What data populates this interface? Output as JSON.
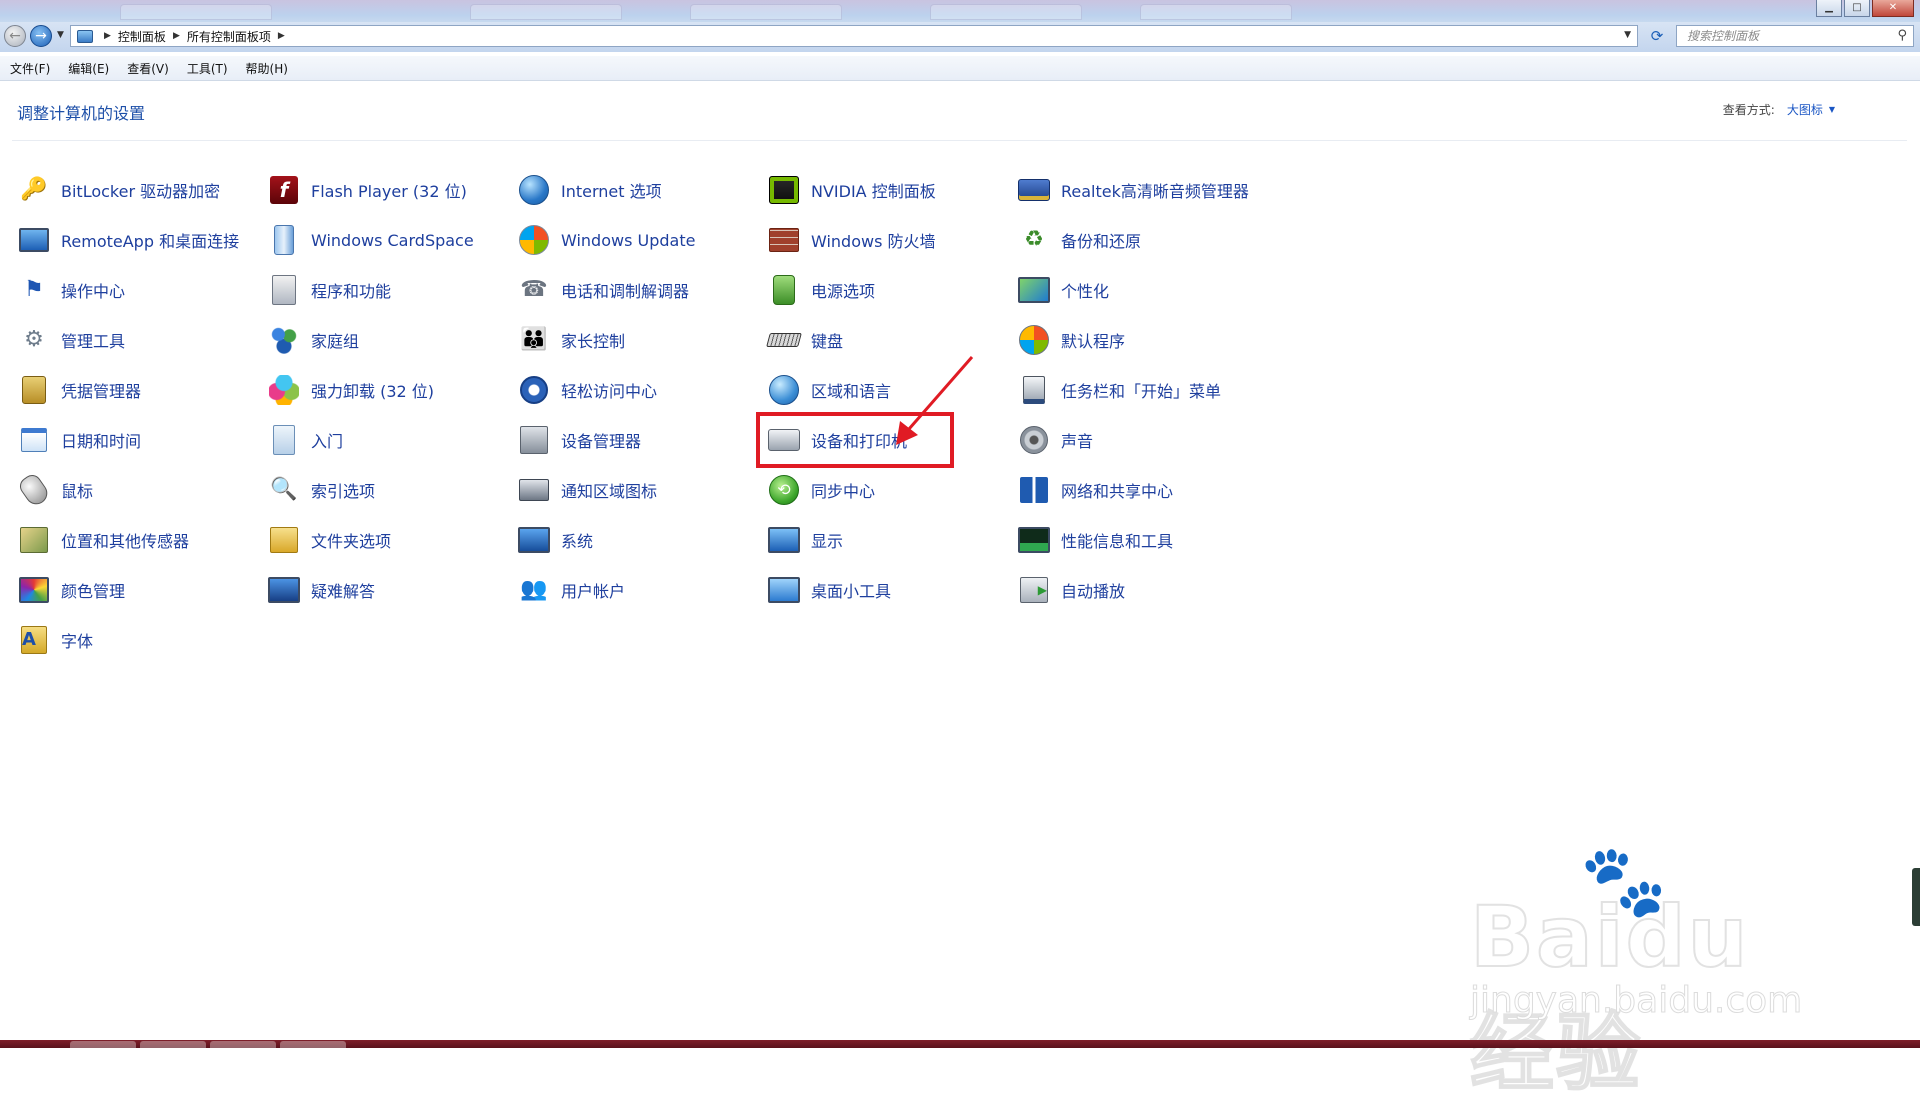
{
  "window": {
    "minimize_glyph": "▁",
    "maximize_glyph": "□",
    "close_glyph": "✕"
  },
  "address": {
    "crumbs": [
      "控制面板",
      "所有控制面板项"
    ],
    "search_placeholder": "搜索控制面板"
  },
  "menu": [
    "文件(F)",
    "编辑(E)",
    "查看(V)",
    "工具(T)",
    "帮助(H)"
  ],
  "content": {
    "heading": "调整计算机的设置",
    "view_by_label": "查看方式:",
    "view_by_value": "大图标"
  },
  "columns": [
    {
      "items": [
        {
          "label": "BitLocker 驱动器加密",
          "icon": "bitlocker-key-icon"
        },
        {
          "label": "RemoteApp 和桌面连接",
          "icon": "remoteapp-icon"
        },
        {
          "label": "操作中心",
          "icon": "action-center-flag-icon"
        },
        {
          "label": "管理工具",
          "icon": "admin-tools-icon"
        },
        {
          "label": "凭据管理器",
          "icon": "credential-manager-icon"
        },
        {
          "label": "日期和时间",
          "icon": "calendar-clock-icon"
        },
        {
          "label": "鼠标",
          "icon": "mouse-icon"
        },
        {
          "label": "位置和其他传感器",
          "icon": "location-sensor-icon"
        },
        {
          "label": "颜色管理",
          "icon": "color-management-icon"
        },
        {
          "label": "字体",
          "icon": "fonts-folder-icon"
        }
      ]
    },
    {
      "items": [
        {
          "label": "Flash Player (32 位)",
          "icon": "flash-player-icon"
        },
        {
          "label": "Windows CardSpace",
          "icon": "cardspace-icon"
        },
        {
          "label": "程序和功能",
          "icon": "programs-features-icon"
        },
        {
          "label": "家庭组",
          "icon": "homegroup-icon"
        },
        {
          "label": "强力卸载 (32 位)",
          "icon": "uninstaller-clover-icon"
        },
        {
          "label": "入门",
          "icon": "getting-started-icon"
        },
        {
          "label": "索引选项",
          "icon": "indexing-magnifier-icon"
        },
        {
          "label": "文件夹选项",
          "icon": "folder-options-icon"
        },
        {
          "label": "疑难解答",
          "icon": "troubleshooting-icon"
        }
      ]
    },
    {
      "items": [
        {
          "label": "Internet 选项",
          "icon": "internet-options-globe-icon"
        },
        {
          "label": "Windows Update",
          "icon": "windows-update-icon"
        },
        {
          "label": "电话和调制解调器",
          "icon": "phone-modem-icon"
        },
        {
          "label": "家长控制",
          "icon": "parental-controls-icon"
        },
        {
          "label": "轻松访问中心",
          "icon": "ease-of-access-icon"
        },
        {
          "label": "设备管理器",
          "icon": "device-manager-icon"
        },
        {
          "label": "通知区域图标",
          "icon": "notification-area-icon"
        },
        {
          "label": "系统",
          "icon": "system-monitor-icon"
        },
        {
          "label": "用户帐户",
          "icon": "user-accounts-icon"
        }
      ]
    },
    {
      "items": [
        {
          "label": "NVIDIA 控制面板",
          "icon": "nvidia-icon"
        },
        {
          "label": "Windows 防火墙",
          "icon": "firewall-brick-icon"
        },
        {
          "label": "电源选项",
          "icon": "power-options-icon"
        },
        {
          "label": "键盘",
          "icon": "keyboard-icon"
        },
        {
          "label": "区域和语言",
          "icon": "region-language-globe-icon"
        },
        {
          "label": "设备和打印机",
          "icon": "printer-icon"
        },
        {
          "label": "同步中心",
          "icon": "sync-center-icon"
        },
        {
          "label": "显示",
          "icon": "display-monitor-icon"
        },
        {
          "label": "桌面小工具",
          "icon": "desktop-gadgets-icon"
        }
      ]
    },
    {
      "items": [
        {
          "label": "Realtek高清晰音频管理器",
          "icon": "realtek-audio-icon"
        },
        {
          "label": "备份和还原",
          "icon": "backup-restore-icon"
        },
        {
          "label": "个性化",
          "icon": "personalization-icon"
        },
        {
          "label": "默认程序",
          "icon": "default-programs-icon"
        },
        {
          "label": "任务栏和「开始」菜单",
          "icon": "taskbar-start-menu-icon"
        },
        {
          "label": "声音",
          "icon": "speaker-icon"
        },
        {
          "label": "网络和共享中心",
          "icon": "network-sharing-icon"
        },
        {
          "label": "性能信息和工具",
          "icon": "performance-tools-icon"
        },
        {
          "label": "自动播放",
          "icon": "autoplay-icon"
        }
      ]
    }
  ],
  "highlighted_item": "设备和打印机",
  "watermark": {
    "brand": "Baidu经验",
    "url": "jingyan.baidu.com"
  },
  "colors": {
    "link": "#1e3f9e",
    "heading": "#1d4fa8",
    "highlight": "#e01b24",
    "taskbar": "#7e1f2a"
  }
}
